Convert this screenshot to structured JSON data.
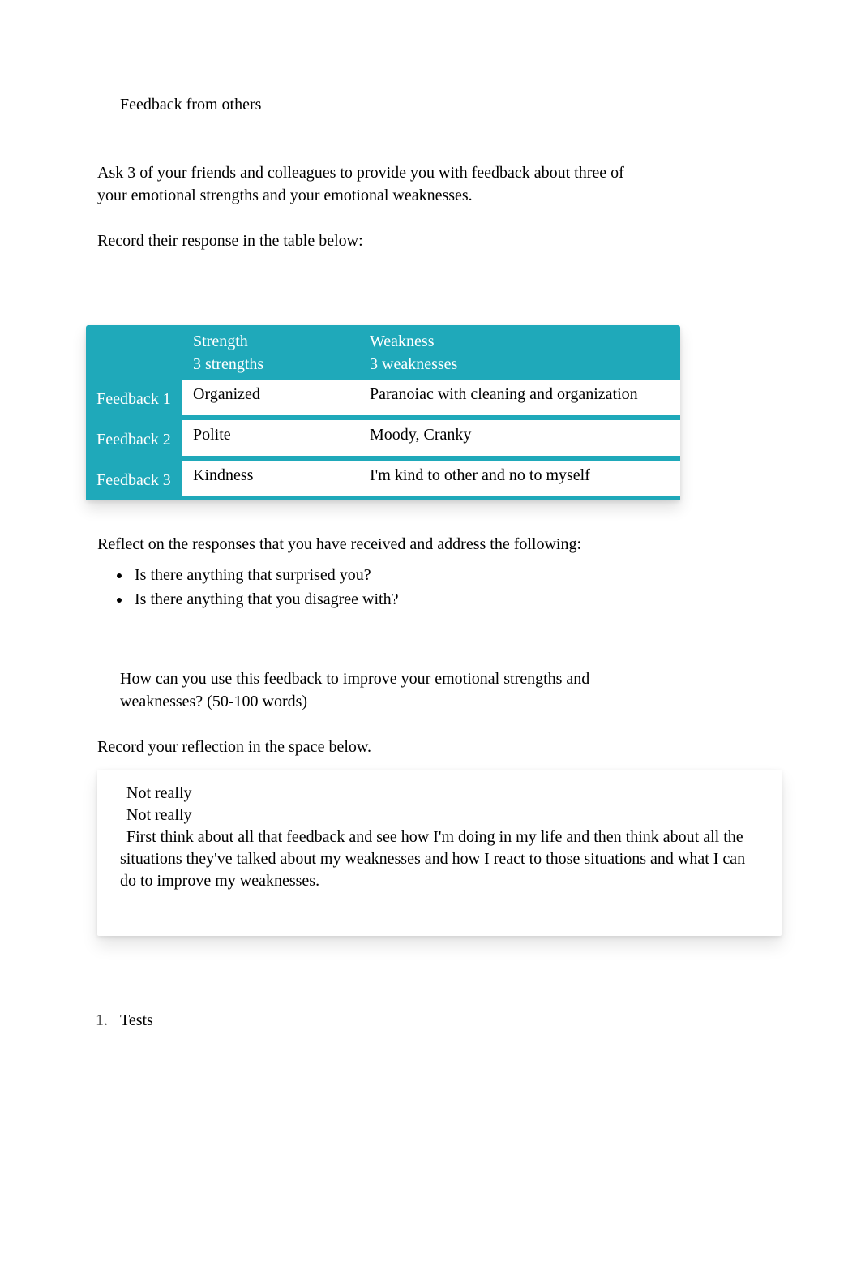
{
  "section_title": "Feedback from others",
  "intro_paragraph": "Ask 3 of your friends and colleagues to provide you with feedback about three of your emotional strengths and your emotional weaknesses.",
  "record_prompt": "Record their response in the table below:",
  "table": {
    "headers": {
      "strength": "Strength",
      "weakness": "Weakness"
    },
    "subheaders": {
      "strength_sub": "3 strengths",
      "weakness_sub": "3 weaknesses"
    },
    "rows": [
      {
        "label": "Feedback 1",
        "strength": "Organized",
        "weakness": "Paranoiac with cleaning and organization"
      },
      {
        "label": "Feedback 2",
        "strength": "Polite",
        "weakness": "Moody, Cranky"
      },
      {
        "label": "Feedback 3",
        "strength": "Kindness",
        "weakness": "I'm kind to other and no to myself"
      }
    ]
  },
  "reflect_intro": "Reflect on the responses that you have received and address the following:",
  "bullets": [
    "Is there anything that surprised you?",
    "Is there anything that you disagree with?"
  ],
  "improve_prompt": "How can you use this feedback to improve your emotional strengths and weaknesses? (50-100 words)",
  "record_reflection": "Record your reflection in the space below.",
  "reflection": {
    "line1": "Not really",
    "line2": "Not really",
    "body": "First think about all that feedback and see how I'm doing in my life and then think about all the situations they've talked about my weaknesses and how I react to those situations and what I can do to improve my weaknesses."
  },
  "ordered_list": [
    "Tests"
  ]
}
